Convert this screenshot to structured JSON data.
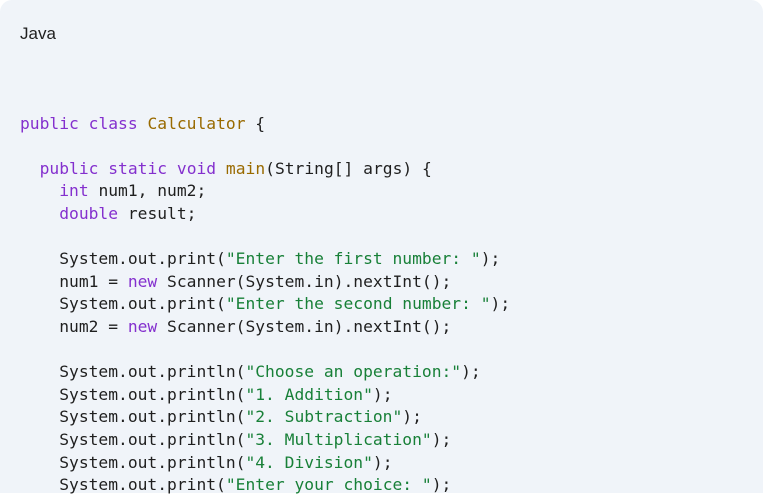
{
  "code_block": {
    "language": "Java",
    "lines": [
      [],
      [
        [
          "kw",
          "public"
        ],
        [
          "pl",
          " "
        ],
        [
          "kw",
          "class"
        ],
        [
          "pl",
          " "
        ],
        [
          "cls",
          "Calculator"
        ],
        [
          "pl",
          " {"
        ]
      ],
      [],
      [
        [
          "pl",
          "  "
        ],
        [
          "kw",
          "public"
        ],
        [
          "pl",
          " "
        ],
        [
          "kw",
          "static"
        ],
        [
          "pl",
          " "
        ],
        [
          "kw",
          "void"
        ],
        [
          "pl",
          " "
        ],
        [
          "fn",
          "main"
        ],
        [
          "pl",
          "(String[] args) {"
        ]
      ],
      [
        [
          "pl",
          "    "
        ],
        [
          "ty",
          "int"
        ],
        [
          "pl",
          " num1, num2;"
        ]
      ],
      [
        [
          "pl",
          "    "
        ],
        [
          "ty",
          "double"
        ],
        [
          "pl",
          " result;"
        ]
      ],
      [],
      [
        [
          "pl",
          "    System.out.print("
        ],
        [
          "str",
          "\"Enter the first number: \""
        ],
        [
          "pl",
          ");"
        ]
      ],
      [
        [
          "pl",
          "    num1 = "
        ],
        [
          "kw",
          "new"
        ],
        [
          "pl",
          " Scanner(System.in).nextInt();"
        ]
      ],
      [
        [
          "pl",
          "    System.out.print("
        ],
        [
          "str",
          "\"Enter the second number: \""
        ],
        [
          "pl",
          ");"
        ]
      ],
      [
        [
          "pl",
          "    num2 = "
        ],
        [
          "kw",
          "new"
        ],
        [
          "pl",
          " Scanner(System.in).nextInt();"
        ]
      ],
      [],
      [
        [
          "pl",
          "    System.out.println("
        ],
        [
          "str",
          "\"Choose an operation:\""
        ],
        [
          "pl",
          ");"
        ]
      ],
      [
        [
          "pl",
          "    System.out.println("
        ],
        [
          "str",
          "\"1. Addition\""
        ],
        [
          "pl",
          ");"
        ]
      ],
      [
        [
          "pl",
          "    System.out.println("
        ],
        [
          "str",
          "\"2. Subtraction\""
        ],
        [
          "pl",
          ");"
        ]
      ],
      [
        [
          "pl",
          "    System.out.println("
        ],
        [
          "str",
          "\"3. Multiplication\""
        ],
        [
          "pl",
          ");"
        ]
      ],
      [
        [
          "pl",
          "    System.out.println("
        ],
        [
          "str",
          "\"4. Division\""
        ],
        [
          "pl",
          ");"
        ]
      ],
      [
        [
          "pl",
          "    System.out.print("
        ],
        [
          "str",
          "\"Enter your choice: \""
        ],
        [
          "pl",
          ");"
        ]
      ]
    ]
  },
  "colors": {
    "background": "#f0f4f9",
    "keyword": "#8430ce",
    "class_and_method": "#996a00",
    "string": "#188038",
    "plain_text": "#1f1f1f"
  }
}
